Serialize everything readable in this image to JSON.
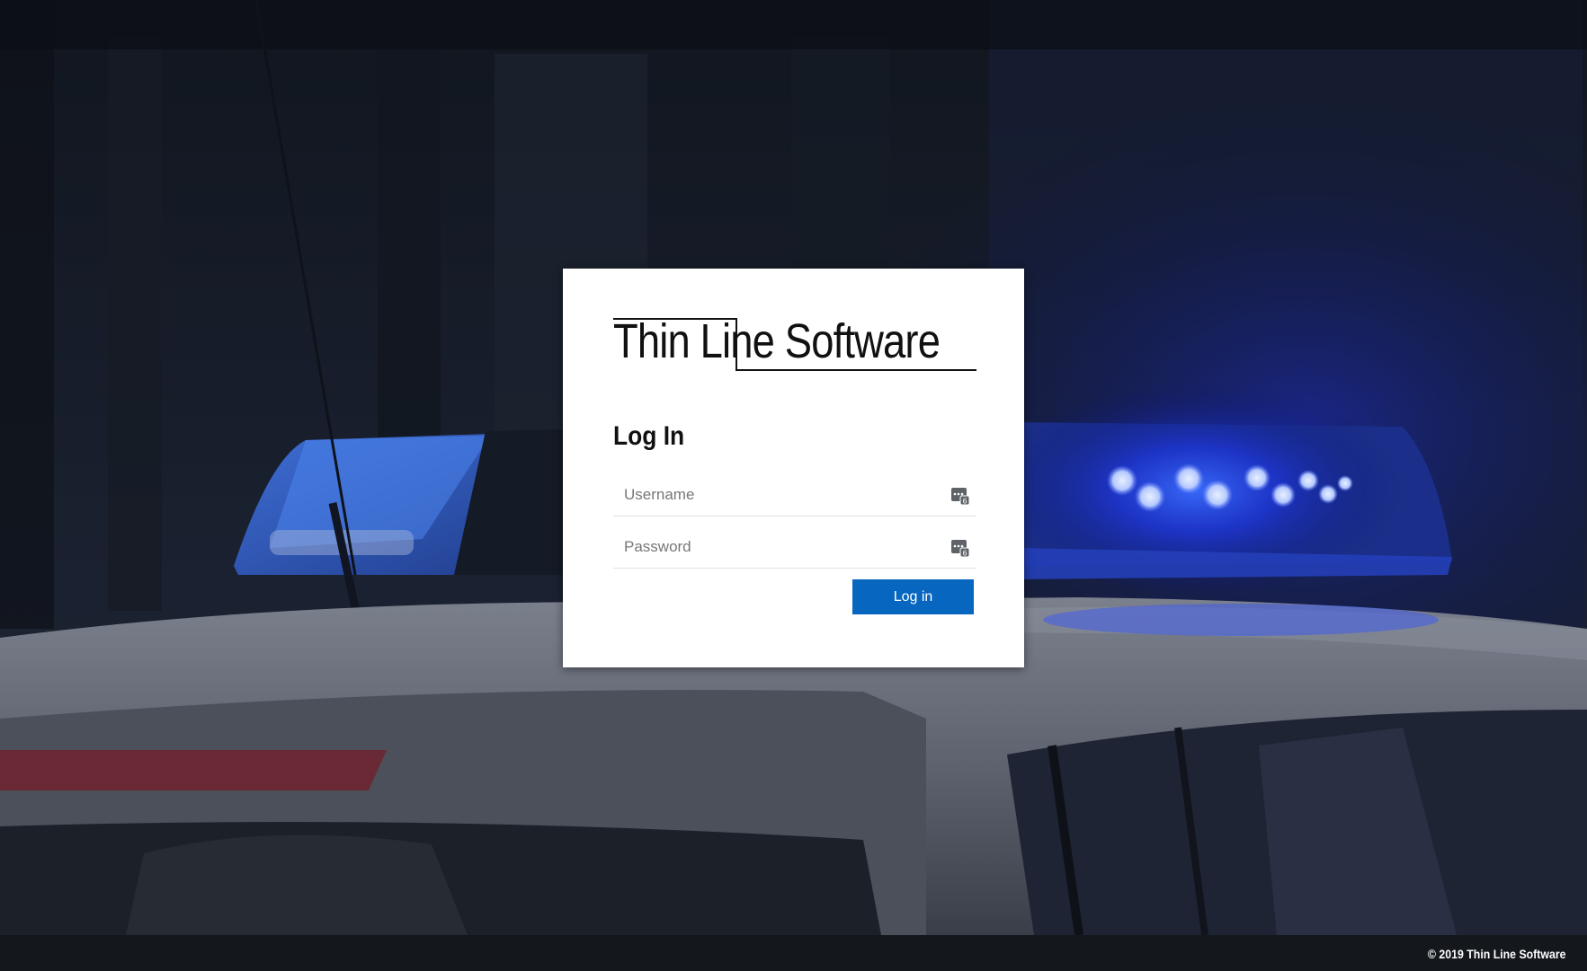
{
  "brand": {
    "logo_text": "Thin Line Software"
  },
  "login": {
    "heading": "Log In",
    "username_placeholder": "Username",
    "password_placeholder": "Password",
    "submit_label": "Log in",
    "field_icon": "password-manager-key-icon"
  },
  "footer": {
    "copyright": "© 2019 Thin Line Software"
  },
  "colors": {
    "button_bg": "#0767c0",
    "button_text": "#ffffff",
    "card_bg": "#ffffff",
    "footer_bg": "#16181c",
    "siren_glow": "#1e3cff"
  }
}
